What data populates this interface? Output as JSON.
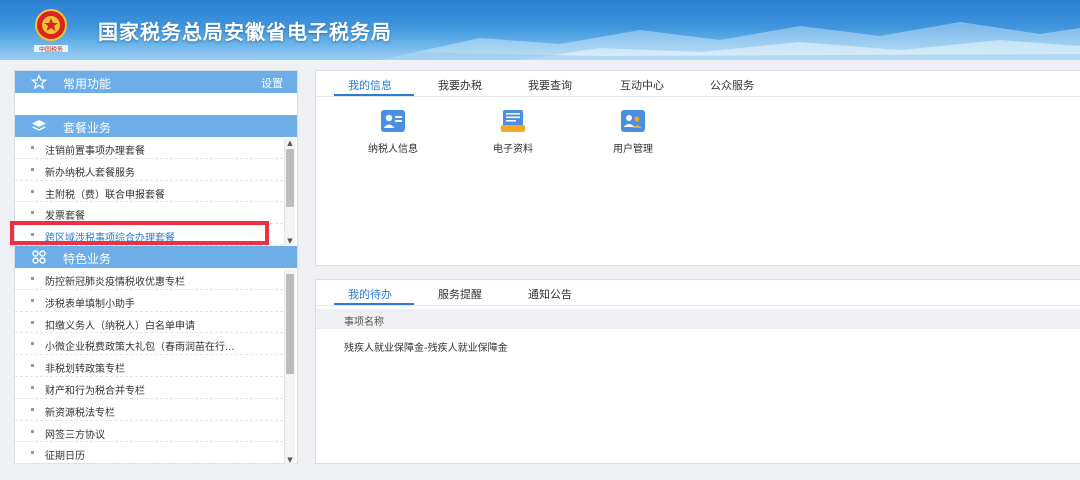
{
  "header": {
    "title": "国家税务总局安徽省电子税务局",
    "emblem_icon": "tax-emblem-icon",
    "emblem_caption": "中国税务"
  },
  "colors": {
    "accent": "#2c7cd0",
    "section_head": "#6daee9",
    "highlight": "#f03040"
  },
  "left": {
    "favorites": {
      "label": "常用功能",
      "setting": "设置",
      "icon": "star-icon"
    },
    "packages": {
      "label": "套餐业务",
      "icon": "layers-icon",
      "items": [
        "注销前置事项办理套餐",
        "新办纳税人套餐服务",
        "主附税（费）联合申报套餐",
        "发票套餐",
        "跨区域涉税事项综合办理套餐"
      ],
      "selected": 4
    },
    "special": {
      "label": "特色业务",
      "icon": "grid-icon",
      "items": [
        "防控新冠肺炎疫情税收优惠专栏",
        "涉税表单填制小助手",
        "扣缴义务人（纳税人）白名单申请",
        "小微企业税费政策大礼包（春雨润苗在行...",
        "非税划转政策专栏",
        "财产和行为税合并专栏",
        "新资源税法专栏",
        "网签三方协议",
        "征期日历"
      ]
    }
  },
  "top_panel": {
    "tabs": [
      "我的信息",
      "我要办税",
      "我要查询",
      "互动中心",
      "公众服务"
    ],
    "active_tab": 0,
    "functions": [
      {
        "label": "纳税人信息",
        "icon": "taxpayer-card-icon"
      },
      {
        "label": "电子资料",
        "icon": "document-stack-icon"
      },
      {
        "label": "用户管理",
        "icon": "users-icon"
      }
    ]
  },
  "bottom_panel": {
    "tabs": [
      "我的待办",
      "服务提醒",
      "通知公告"
    ],
    "active_tab": 0,
    "column_header": "事项名称",
    "rows": [
      "残疾人就业保障金-残疾人就业保障金"
    ]
  }
}
